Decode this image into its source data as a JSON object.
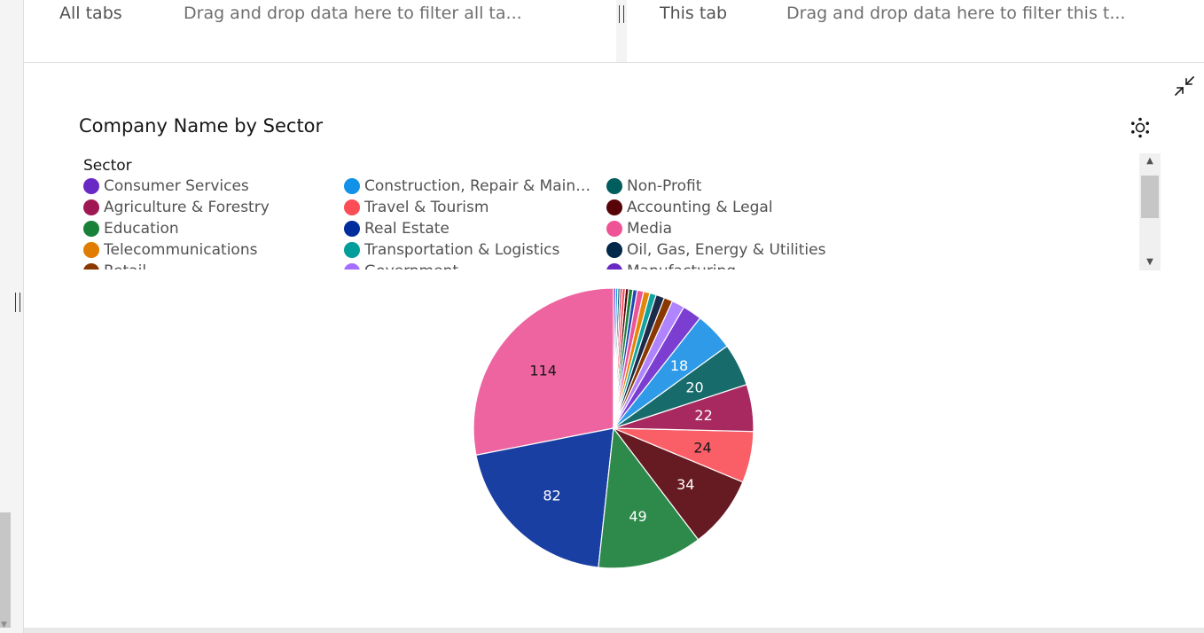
{
  "filter_bar": {
    "all_tabs_label": "All tabs",
    "all_tabs_drop": "Drag and drop data here to filter all ta...",
    "this_tab_label": "This tab",
    "this_tab_drop": "Drag and drop data here to filter this t..."
  },
  "icons": {
    "collapse": "collapse-arrows-icon",
    "settings": "settings-gear-icon"
  },
  "chart_data": {
    "type": "pie",
    "title": "Company Name by Sector",
    "legend": {
      "title": "Sector",
      "placement": "top",
      "items": [
        {
          "label": "Consumer Services",
          "color": "#6929c4"
        },
        {
          "label": "Construction, Repair & Maintenan...",
          "color": "#1192e8"
        },
        {
          "label": "Non-Profit",
          "color": "#005d5d"
        },
        {
          "label": "Agriculture & Forestry",
          "color": "#9f1853"
        },
        {
          "label": "Travel & Tourism",
          "color": "#fa4d56"
        },
        {
          "label": "Accounting & Legal",
          "color": "#570408"
        },
        {
          "label": "Education",
          "color": "#198038"
        },
        {
          "label": "Real Estate",
          "color": "#002d9c"
        },
        {
          "label": "Media",
          "color": "#ee5396"
        },
        {
          "label": "Telecommunications",
          "color": "#e07c00"
        },
        {
          "label": "Transportation & Logistics",
          "color": "#009d9a"
        },
        {
          "label": "Oil, Gas, Energy & Utilities",
          "color": "#012749"
        },
        {
          "label": "Retail",
          "color": "#8a3800"
        },
        {
          "label": "Government",
          "color": "#a56eff"
        },
        {
          "label": "Manufacturing",
          "color": "#6929c4"
        }
      ]
    },
    "slices": [
      {
        "value": 114,
        "color": "#ee64a0",
        "label": "114",
        "label_color": "#161616"
      },
      {
        "value": 82,
        "color": "#1a3fa3",
        "label": "82",
        "label_color": "#ffffff"
      },
      {
        "value": 49,
        "color": "#2e8a4b",
        "label": "49",
        "label_color": "#ffffff"
      },
      {
        "value": 34,
        "color": "#661a22",
        "label": "34",
        "label_color": "#ffffff"
      },
      {
        "value": 24,
        "color": "#fa5f68",
        "label": "24",
        "label_color": "#161616"
      },
      {
        "value": 22,
        "color": "#a8295f",
        "label": "22",
        "label_color": "#ffffff"
      },
      {
        "value": 20,
        "color": "#176b6b",
        "label": "20",
        "label_color": "#ffffff"
      },
      {
        "value": 18,
        "color": "#2f9be8",
        "label": "18",
        "label_color": "#ffffff"
      },
      {
        "value": 9,
        "color": "#7b3ed0",
        "label": "",
        "label_color": "#ffffff"
      },
      {
        "value": 6,
        "color": "#b184ff",
        "label": "",
        "label_color": "#ffffff"
      },
      {
        "value": 4,
        "color": "#8a3800",
        "label": "",
        "label_color": "#ffffff"
      },
      {
        "value": 4,
        "color": "#1c2b4a",
        "label": "",
        "label_color": "#ffffff"
      },
      {
        "value": 3,
        "color": "#12a3a0",
        "label": "",
        "label_color": "#ffffff"
      },
      {
        "value": 3,
        "color": "#e3870c",
        "label": "",
        "label_color": "#ffffff"
      },
      {
        "value": 3,
        "color": "#ee5396",
        "label": "",
        "label_color": "#ffffff"
      },
      {
        "value": 2,
        "color": "#1f47b8",
        "label": "",
        "label_color": "#ffffff"
      },
      {
        "value": 2,
        "color": "#198038",
        "label": "",
        "label_color": "#ffffff"
      },
      {
        "value": 1.5,
        "color": "#570408",
        "label": "",
        "label_color": "#ffffff"
      },
      {
        "value": 1.5,
        "color": "#fa4d56",
        "label": "",
        "label_color": "#ffffff"
      },
      {
        "value": 1,
        "color": "#9f1853",
        "label": "",
        "label_color": "#ffffff"
      },
      {
        "value": 1,
        "color": "#005d5d",
        "label": "",
        "label_color": "#ffffff"
      },
      {
        "value": 1,
        "color": "#1192e8",
        "label": "",
        "label_color": "#ffffff"
      },
      {
        "value": 1,
        "color": "#6929c4",
        "label": "",
        "label_color": "#ffffff"
      }
    ]
  }
}
